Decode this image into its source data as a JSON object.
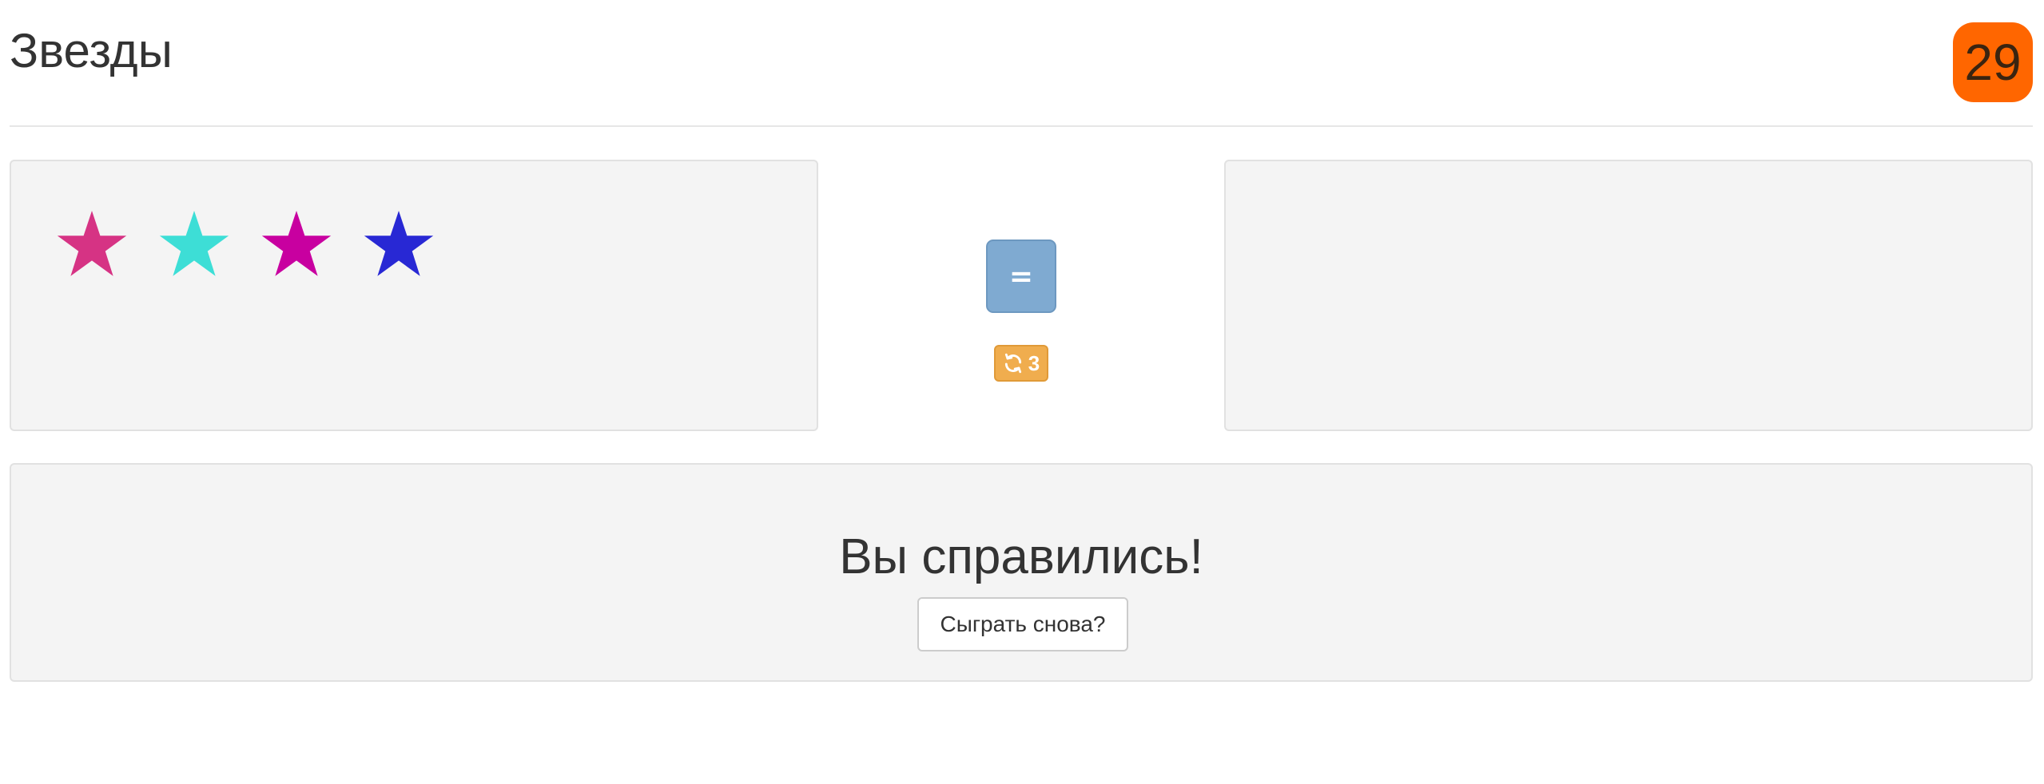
{
  "header": {
    "title": "Звезды",
    "timer": "29"
  },
  "left_panel": {
    "stars": [
      {
        "color": "#d63384"
      },
      {
        "color": "#3dded6"
      },
      {
        "color": "#c800a0"
      },
      {
        "color": "#2828d4"
      }
    ]
  },
  "right_panel": {
    "stars": []
  },
  "controls": {
    "equals_label": "=",
    "retry_count": "3",
    "retry_icon": "refresh-icon"
  },
  "result": {
    "message": "Вы справились!",
    "play_again_label": "Сыграть снова?"
  },
  "colors": {
    "timer": "#ff6600",
    "equals_button": "#7faad1",
    "retry_badge": "#f0ad4e",
    "panel": "#f4f4f4"
  }
}
